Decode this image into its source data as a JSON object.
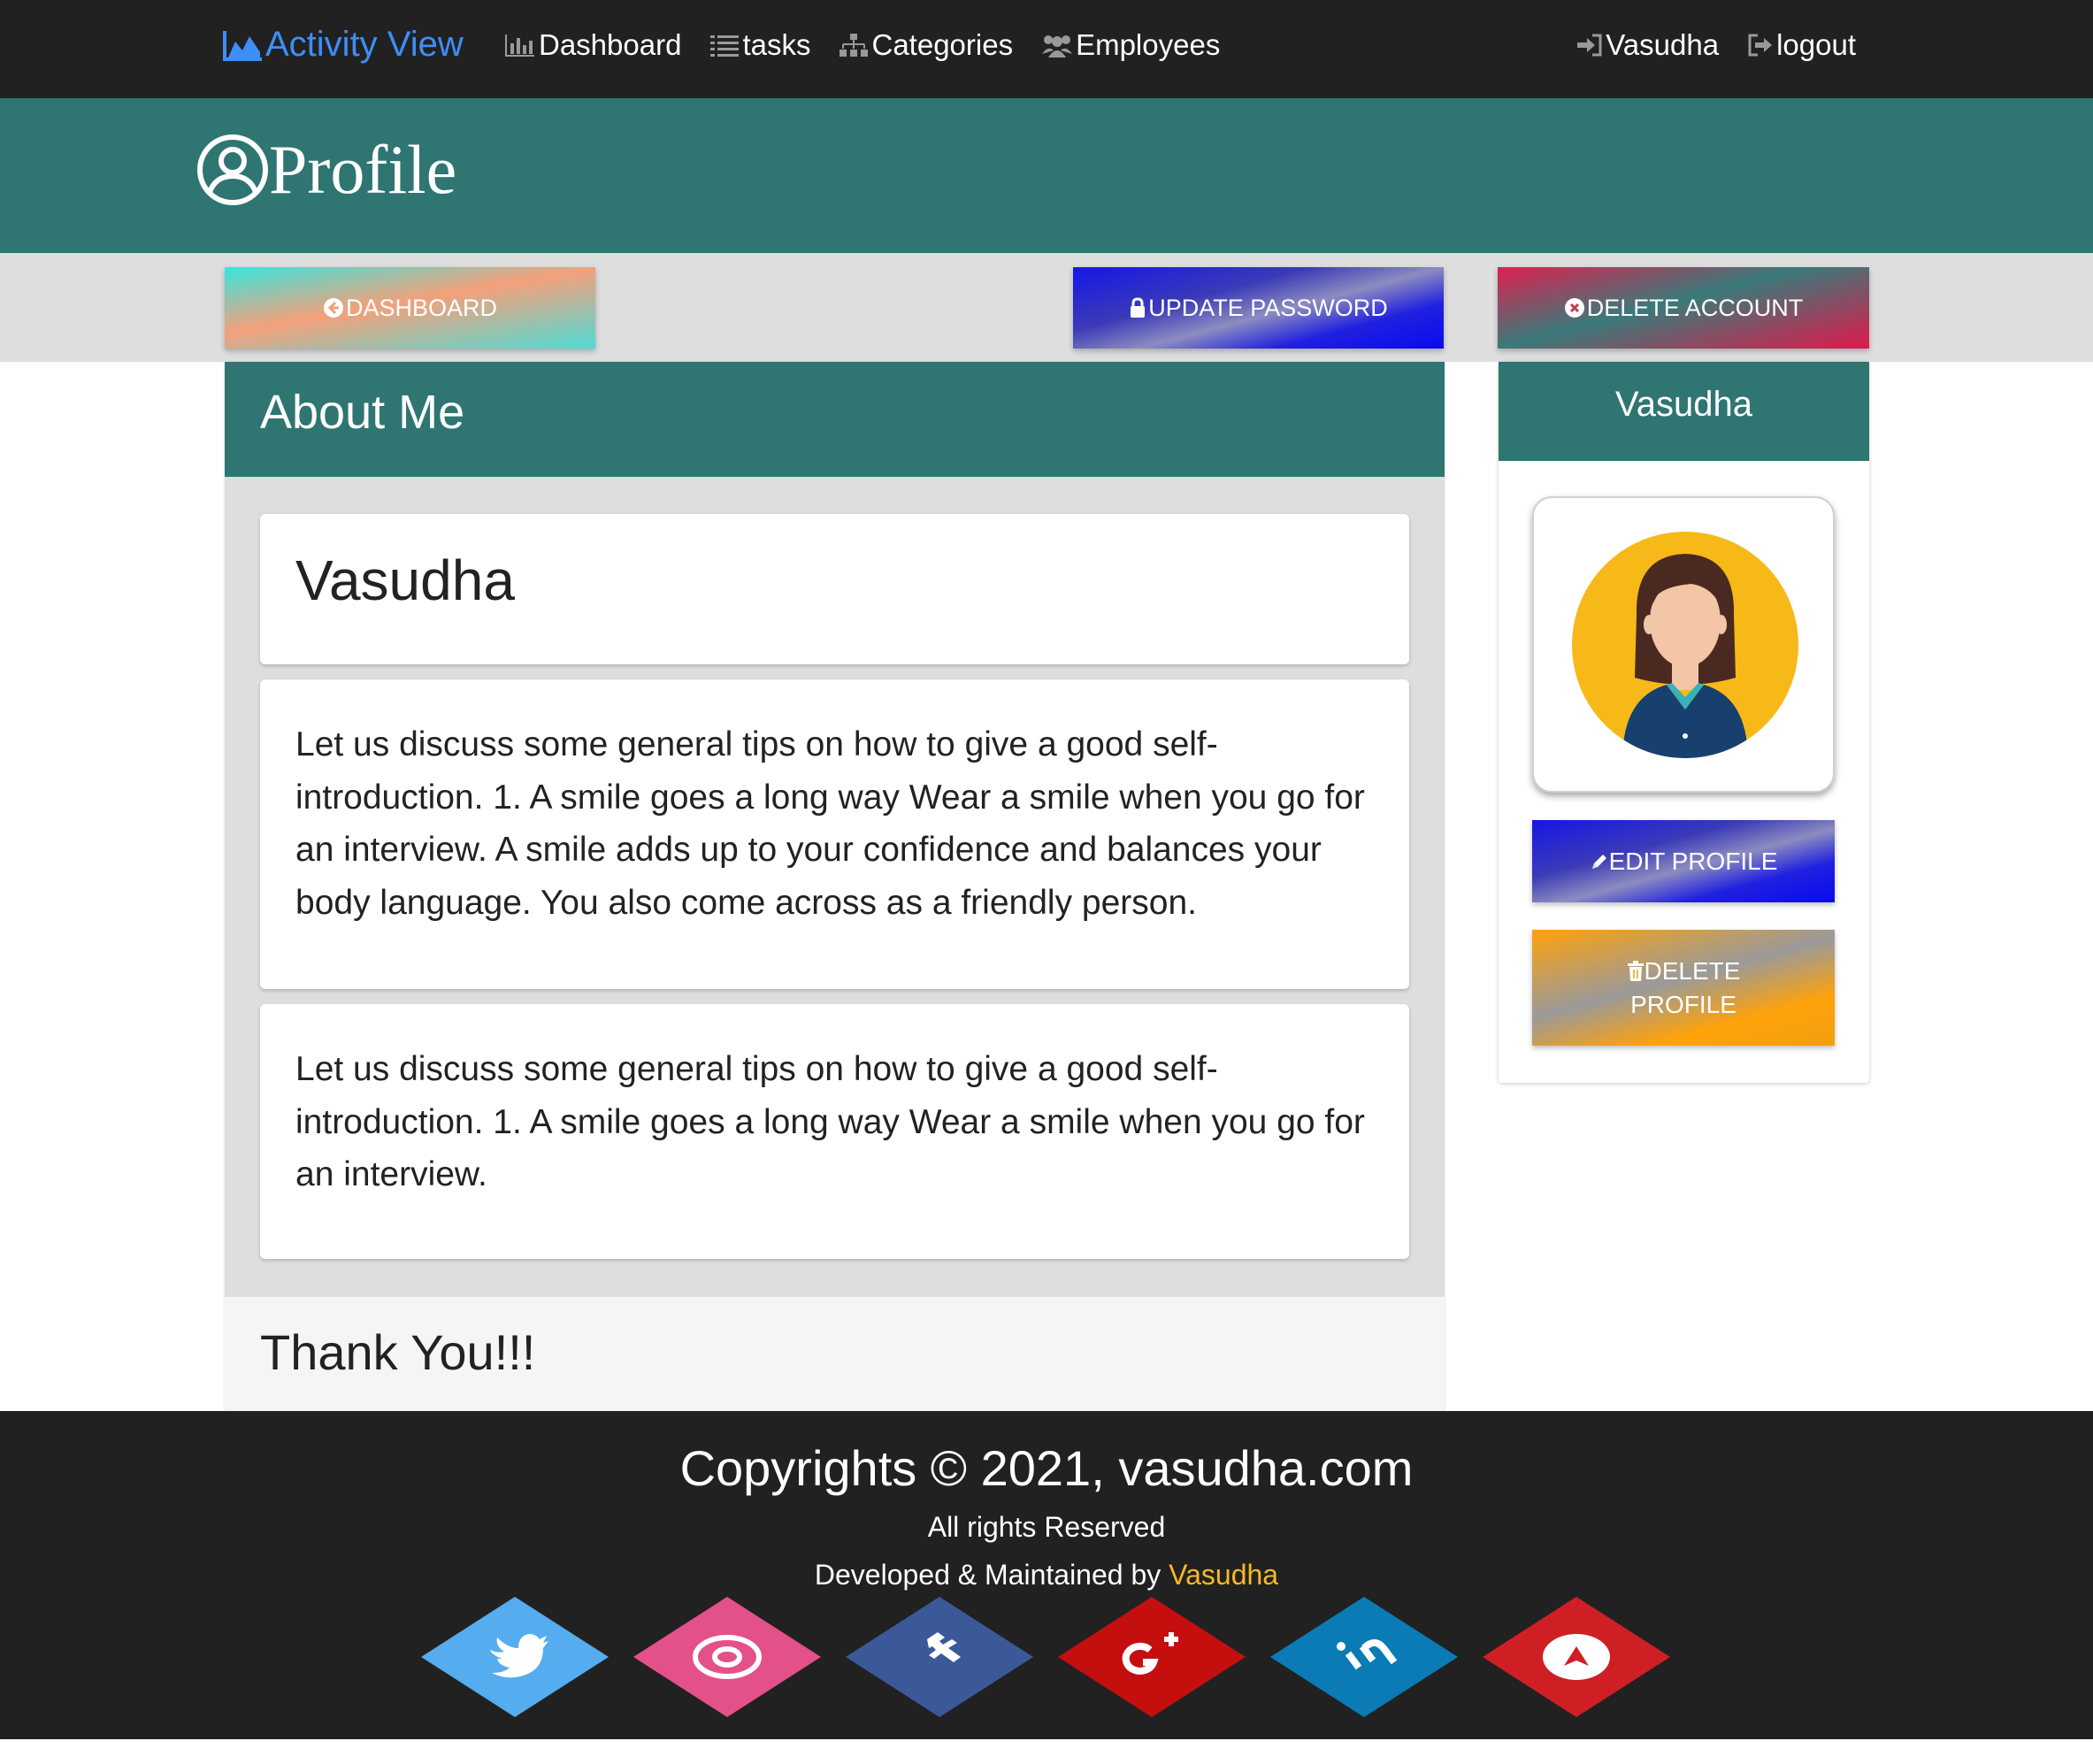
{
  "navbar": {
    "brand": "Activity View",
    "links": [
      "Dashboard",
      "tasks",
      "Categories",
      "Employees"
    ],
    "user": "Vasudha",
    "logout": "logout"
  },
  "banner": {
    "title": "Profile"
  },
  "actions": {
    "dashboard": "DASHBOARD",
    "update_password": "UPDATE PASSWORD",
    "delete_account": "DELETE ACCOUNT"
  },
  "about": {
    "heading": "About Me",
    "name": "Vasudha",
    "paragraph1": "Let us discuss some general tips on how to give a good self-introduction. 1. A smile goes a long way Wear a smile when you go for an interview. A smile adds up to your confidence and balances your body language. You also come across as a friendly person.",
    "paragraph2": "Let us discuss some general tips on how to give a good self-introduction. 1. A smile goes a long way Wear a smile when you go for an interview.",
    "footer": "Thank You!!!"
  },
  "side": {
    "name": "Vasudha",
    "edit_label": "EDIT PROFILE",
    "delete_label_1": "DELETE",
    "delete_label_2": "PROFILE"
  },
  "footer": {
    "copyright": "Copyrights © 2021, vasudha.com",
    "rights": "All rights Reserved",
    "developed_prefix": "Developed & Maintained by",
    "developer": "Vasudha",
    "socials": [
      {
        "name": "twitter-icon",
        "color": "#55acee"
      },
      {
        "name": "instagram-icon",
        "color": "#e4508a"
      },
      {
        "name": "facebook-icon",
        "color": "#3b5998"
      },
      {
        "name": "google-plus-icon",
        "color": "#c50f0f"
      },
      {
        "name": "linkedin-icon",
        "color": "#0b7bb5"
      },
      {
        "name": "youtube-icon",
        "color": "#cf1f25"
      }
    ]
  }
}
